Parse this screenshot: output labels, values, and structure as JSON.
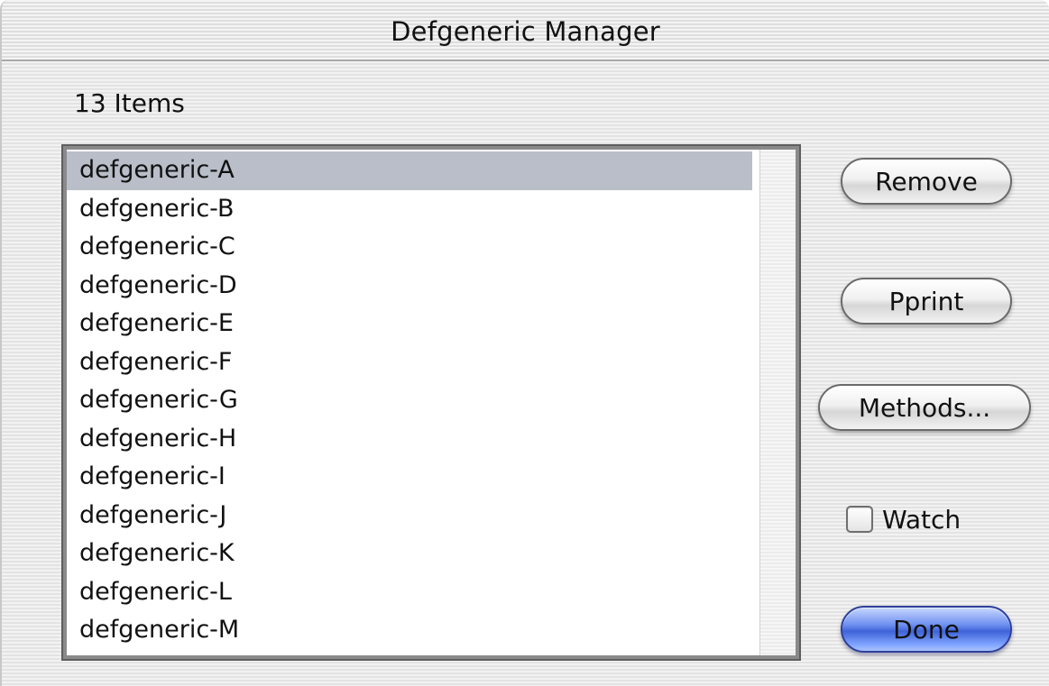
{
  "window": {
    "title": "Defgeneric Manager"
  },
  "list": {
    "count_label": "13 Items",
    "items": [
      "defgeneric-A",
      "defgeneric-B",
      "defgeneric-C",
      "defgeneric-D",
      "defgeneric-E",
      "defgeneric-F",
      "defgeneric-G",
      "defgeneric-H",
      "defgeneric-I",
      "defgeneric-J",
      "defgeneric-K",
      "defgeneric-L",
      "defgeneric-M"
    ],
    "selected_index": 0
  },
  "buttons": {
    "remove": "Remove",
    "pprint": "Pprint",
    "methods": "Methods...",
    "done": "Done"
  },
  "watch": {
    "label": "Watch",
    "checked": false
  },
  "colors": {
    "selection": "#b9bec8",
    "default_button": "#3f63d8"
  }
}
